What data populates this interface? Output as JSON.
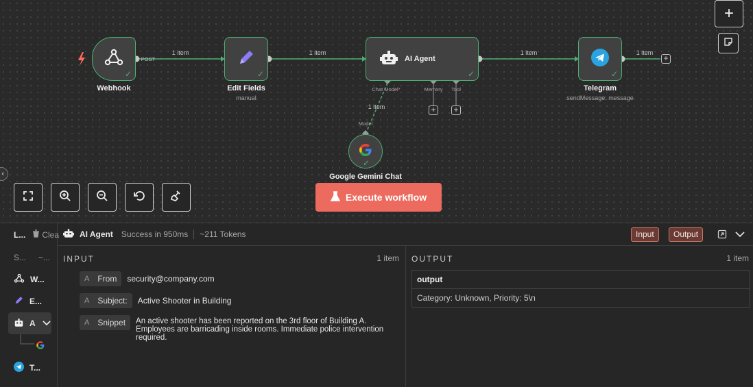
{
  "canvas": {
    "nodes": {
      "webhook": {
        "name": "Webhook",
        "icon": "webhook-icon"
      },
      "edit_fields": {
        "name": "Edit Fields",
        "subtitle": "manual",
        "icon": "pencil-icon"
      },
      "ai_agent": {
        "name": "AI Agent",
        "icon": "robot-icon"
      },
      "telegram": {
        "name": "Telegram",
        "subtitle": "sendMessage: message",
        "icon": "telegram-icon"
      },
      "gemini": {
        "name": "Google Gemini Chat",
        "icon": "google-icon"
      }
    },
    "edge_labels": {
      "webhook_method": "POST",
      "webhook_to_edit": "1 item",
      "edit_to_agent": "1 item",
      "agent_to_telegram": "1 item",
      "telegram_out": "1 item",
      "model_link": "1 item"
    },
    "ports": {
      "chat_model": "Chat Model",
      "chat_model_required": "*",
      "memory": "Memory",
      "tool": "Tool",
      "model": "Model"
    },
    "execute_button": "Execute workflow",
    "controls": [
      "fit-view",
      "zoom-in",
      "zoom-out",
      "reset",
      "tidy-up"
    ],
    "colors": {
      "success": "#4caf73",
      "accent": "#ec6a5e"
    }
  },
  "panel": {
    "sidebar": {
      "header_label": "L...",
      "clear_label": "Clea",
      "sub_a": "S...",
      "sub_b": "~...",
      "items": [
        {
          "label": "W...",
          "icon": "webhook-icon"
        },
        {
          "label": "E...",
          "icon": "pencil-icon"
        },
        {
          "label": "A",
          "icon": "robot-icon"
        },
        {
          "label": "",
          "icon": "google-icon"
        },
        {
          "label": "T...",
          "icon": "telegram-icon"
        }
      ]
    },
    "header": {
      "title": "AI Agent",
      "status": "Success in 950ms",
      "tokens": "~211 Tokens",
      "input_btn": "Input",
      "output_btn": "Output"
    },
    "input": {
      "title": "INPUT",
      "count": "1 item",
      "fields": [
        {
          "type": "A",
          "key": "From",
          "value": "security@company.com"
        },
        {
          "type": "A",
          "key": "Subject:",
          "value": "Active Shooter in Building"
        },
        {
          "type": "A",
          "key": "Snippet",
          "value": "An active shooter has been reported on the 3rd floor of Building A. Employees are barricading inside rooms. Immediate police intervention required."
        }
      ]
    },
    "output": {
      "title": "OUTPUT",
      "count": "1 item",
      "column": "output",
      "value": "Category: Unknown, Priority: 5\\n"
    }
  }
}
